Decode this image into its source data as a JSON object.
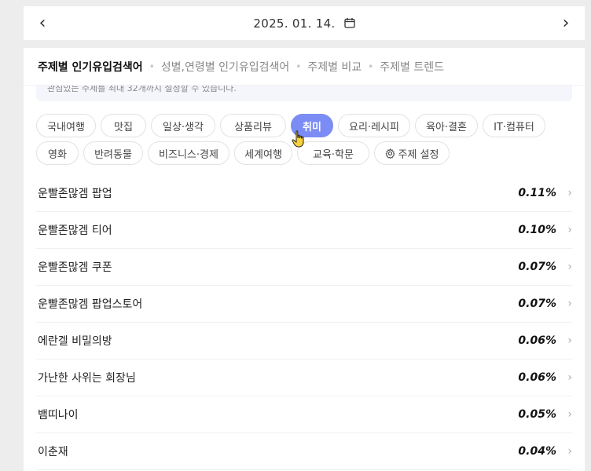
{
  "date_nav": {
    "prev": "‹",
    "date": "2025. 01. 14.",
    "next": "›"
  },
  "tabs": [
    {
      "label": "주제별 인기유입검색어",
      "active": true
    },
    {
      "label": "성별,연령별 인기유입검색어",
      "active": false
    },
    {
      "label": "주제별 비교",
      "active": false
    },
    {
      "label": "주제별 트렌드",
      "active": false
    }
  ],
  "tab_separator": "•",
  "notice": "관심있는 주제를 최대 32개까지 설정할 수 있습니다.",
  "chips_row1": [
    "국내여행",
    "맛집",
    "일상·생각",
    "상품리뷰",
    "취미",
    "요리·레시피",
    "육아·결혼",
    "IT·컴퓨터"
  ],
  "chips_row2": [
    "영화",
    "반려동물",
    "비즈니스·경제",
    "세계여행",
    "교육·학문"
  ],
  "settings_chip": "주제 설정",
  "active_chip": "취미",
  "keywords": [
    {
      "keyword": "운빨존많겜 팝업",
      "percent": "0.11%"
    },
    {
      "keyword": "운빨존많겜 티어",
      "percent": "0.10%"
    },
    {
      "keyword": "운빨존많겜 쿠폰",
      "percent": "0.07%"
    },
    {
      "keyword": "운빨존많겜 팝업스토어",
      "percent": "0.07%"
    },
    {
      "keyword": "에란겔 비밀의방",
      "percent": "0.06%"
    },
    {
      "keyword": "가난한 사위는 회장님",
      "percent": "0.06%"
    },
    {
      "keyword": "뱀띠나이",
      "percent": "0.05%"
    },
    {
      "keyword": "이춘재",
      "percent": "0.04%"
    }
  ],
  "row_chevron": "›",
  "colors": {
    "accent": "#7b8cf5",
    "background": "#ededed"
  },
  "icons": {
    "date": "calendar-icon",
    "settings": "gear-icon",
    "cursor": "hand-pointer-icon"
  }
}
